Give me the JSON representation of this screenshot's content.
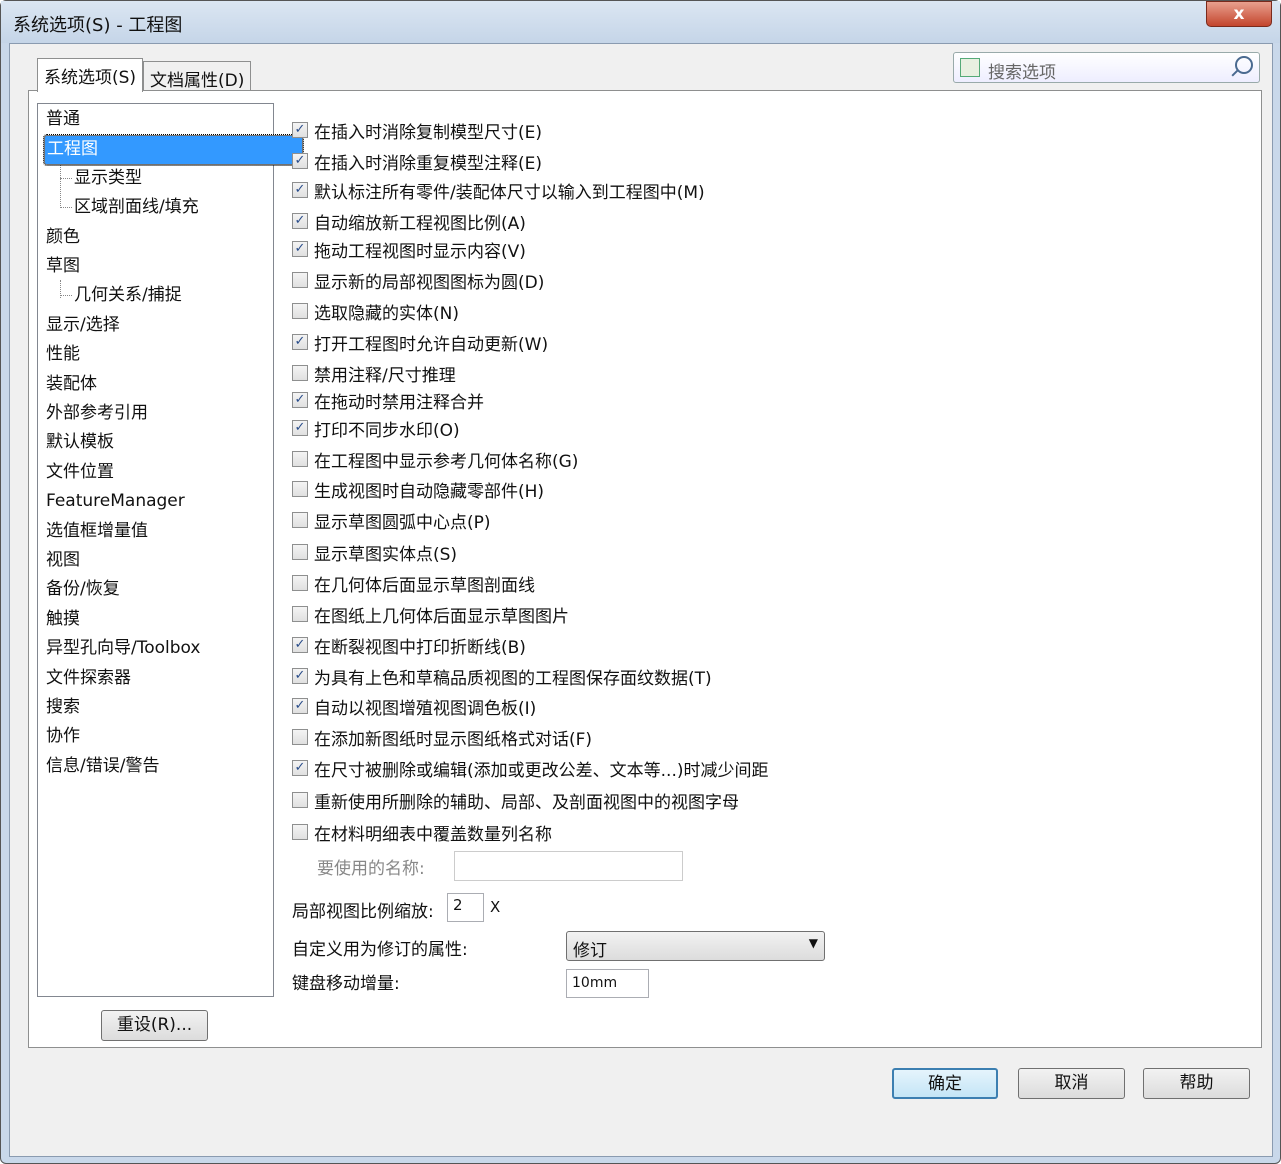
{
  "window": {
    "title": "系统选项(S) - 工程图",
    "close": "x"
  },
  "tabs": [
    {
      "label": "系统选项(S)"
    },
    {
      "label": "文档属性(D)"
    }
  ],
  "search": {
    "placeholder": "搜索选项"
  },
  "tree": [
    {
      "label": "普通",
      "level": 0
    },
    {
      "label": "工程图",
      "level": 0,
      "selected": true
    },
    {
      "label": "显示类型",
      "level": 1
    },
    {
      "label": "区域剖面线/填充",
      "level": 1
    },
    {
      "label": "颜色",
      "level": 0
    },
    {
      "label": "草图",
      "level": 0
    },
    {
      "label": "几何关系/捕捉",
      "level": 1
    },
    {
      "label": "显示/选择",
      "level": 0
    },
    {
      "label": "性能",
      "level": 0
    },
    {
      "label": "装配体",
      "level": 0
    },
    {
      "label": "外部参考引用",
      "level": 0
    },
    {
      "label": "默认模板",
      "level": 0
    },
    {
      "label": "文件位置",
      "level": 0
    },
    {
      "label": "FeatureManager",
      "level": 0
    },
    {
      "label": "选值框增量值",
      "level": 0
    },
    {
      "label": "视图",
      "level": 0
    },
    {
      "label": "备份/恢复",
      "level": 0
    },
    {
      "label": "触摸",
      "level": 0
    },
    {
      "label": "异型孔向导/Toolbox",
      "level": 0
    },
    {
      "label": "文件探索器",
      "level": 0
    },
    {
      "label": "搜索",
      "level": 0
    },
    {
      "label": "协作",
      "level": 0
    },
    {
      "label": "信息/错误/警告",
      "level": 0
    }
  ],
  "options": [
    {
      "label": "在插入时消除复制模型尺寸(E)",
      "checked": true
    },
    {
      "label": "在插入时消除重复模型注释(E)",
      "checked": true
    },
    {
      "label": "默认标注所有零件/装配体尺寸以输入到工程图中(M)",
      "checked": true
    },
    {
      "label": "自动缩放新工程视图比例(A)",
      "checked": true
    },
    {
      "label": "拖动工程视图时显示内容(V)",
      "checked": true
    },
    {
      "label": "显示新的局部视图图标为圆(D)",
      "checked": false
    },
    {
      "label": "选取隐藏的实体(N)",
      "checked": false
    },
    {
      "label": "打开工程图时允许自动更新(W)",
      "checked": true
    },
    {
      "label": "禁用注释/尺寸推理",
      "checked": false
    },
    {
      "label": "在拖动时禁用注释合并",
      "checked": true
    },
    {
      "label": "打印不同步水印(O)",
      "checked": true
    },
    {
      "label": "在工程图中显示参考几何体名称(G)",
      "checked": false
    },
    {
      "label": "生成视图时自动隐藏零部件(H)",
      "checked": false
    },
    {
      "label": "显示草图圆弧中心点(P)",
      "checked": false
    },
    {
      "label": "显示草图实体点(S)",
      "checked": false
    },
    {
      "label": "在几何体后面显示草图剖面线",
      "checked": false
    },
    {
      "label": "在图纸上几何体后面显示草图图片",
      "checked": false
    },
    {
      "label": "在断裂视图中打印折断线(B)",
      "checked": true
    },
    {
      "label": "为具有上色和草稿品质视图的工程图保存面纹数据(T)",
      "checked": true
    },
    {
      "label": "自动以视图增殖视图调色板(I)",
      "checked": true
    },
    {
      "label": "在添加新图纸时显示图纸格式对话(F)",
      "checked": false
    },
    {
      "label": "在尺寸被删除或编辑(添加或更改公差、文本等...)时减少间距",
      "checked": true
    },
    {
      "label": "重新使用所删除的辅助、局部、及剖面视图中的视图字母",
      "checked": false
    },
    {
      "label": "在材料明细表中覆盖数量列名称",
      "checked": false
    }
  ],
  "fields": {
    "name_label": "要使用的名称:",
    "name_value": "",
    "scale_label": "局部视图比例缩放:",
    "scale_value": "2",
    "scale_unit": "X",
    "rev_label": "自定义用为修订的属性:",
    "rev_value": "修订",
    "step_label": "键盘移动增量:",
    "step_value": "10mm"
  },
  "buttons": {
    "reset": "重设(R)...",
    "ok": "确定",
    "cancel": "取消",
    "help": "帮助"
  }
}
